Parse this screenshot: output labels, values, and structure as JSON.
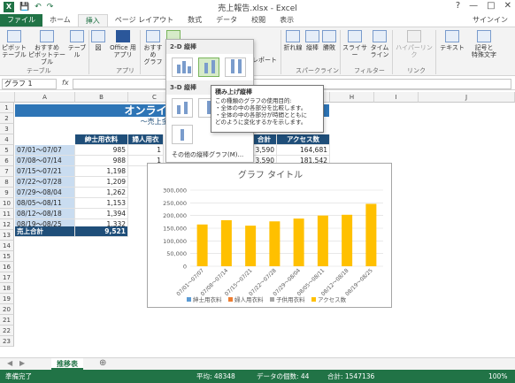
{
  "window": {
    "title": "売上報告.xlsx - Excel",
    "signin": "サインイン",
    "qat_icons": [
      "save-icon",
      "undo-icon",
      "redo-icon"
    ],
    "controls": [
      "?",
      "—",
      "□",
      "✕"
    ]
  },
  "tabs": [
    "ファイル",
    "ホーム",
    "挿入",
    "ページ レイアウト",
    "数式",
    "データ",
    "校閲",
    "表示"
  ],
  "active_tab": "挿入",
  "ribbon": {
    "buttons": [
      {
        "label": "ピボット\nテーブル"
      },
      {
        "label": "おすすめ\nピボットテーブル"
      },
      {
        "label": "テーブル"
      },
      {
        "label": "図"
      },
      {
        "label": "Office 用\nアプリ"
      },
      {
        "label": "おすすめ\nグラフ"
      },
      {
        "label": "レポート"
      },
      {
        "label": "折れ線"
      },
      {
        "label": "縦棒"
      },
      {
        "label": "勝敗"
      },
      {
        "label": "スライサー"
      },
      {
        "label": "タイム\nライン"
      },
      {
        "label": "ハイパーリンク"
      },
      {
        "label": "テキスト"
      },
      {
        "label": "記号と\n特殊文字"
      }
    ],
    "groups": [
      "テーブル",
      "アプリ",
      "スパークライン",
      "フィルター",
      "リンク"
    ]
  },
  "formula_bar": {
    "name_box": "グラフ 1",
    "fx": "fx",
    "value": ""
  },
  "columns": [
    "A",
    "B",
    "C",
    "D",
    "E",
    "F",
    "G",
    "H",
    "I",
    "J"
  ],
  "rows": [
    "1",
    "2",
    "3",
    "4",
    "5",
    "6",
    "7",
    "8",
    "9",
    "10",
    "11",
    "12",
    "13",
    "14",
    "15",
    "16",
    "17",
    "18",
    "19",
    "20",
    "21",
    "22",
    "23"
  ],
  "sheet": {
    "banner": "オンラインショップ",
    "subbanner": "～売上金額・ホーム",
    "col_headers": [
      "紳士用衣料",
      "婦人用衣",
      "合計",
      "アクセス数"
    ],
    "periods": [
      "07/01～07/07",
      "07/08～07/14",
      "07/15～07/21",
      "07/22～07/28",
      "07/29～08/04",
      "08/05～08/11",
      "08/12～08/18",
      "08/19～08/25"
    ],
    "mens": [
      "985",
      "988",
      "1,198",
      "1,209",
      "1,262",
      "1,153",
      "1,394",
      "1,332"
    ],
    "womens_partial": [
      "1",
      "1"
    ],
    "totals_partial": [
      "3,590",
      "3,590"
    ],
    "access": [
      "164,681",
      "181,542"
    ],
    "total_label": "売上合計",
    "total_mens": "9,521"
  },
  "dropdown": {
    "header_2d": "2-D 縦棒",
    "header_3d": "3-D 縦棒",
    "more": "その他の縦棒グラフ(M)..."
  },
  "tooltip": {
    "title": "積み上げ縦棒",
    "body": "この種類のグラフの使用目的:\n・全体の中の各部分を比較します。\n・全体の中の各部分が時間とともに\n  どのように変化するかを示します。"
  },
  "chart_data": {
    "type": "bar",
    "title": "グラフ タイトル",
    "categories": [
      "07/01～07/07",
      "07/08～07/14",
      "07/15～07/21",
      "07/22～07/28",
      "07/29～08/04",
      "08/05～08/11",
      "08/12～08/18",
      "08/19～08/25"
    ],
    "series": [
      {
        "name": "紳士用衣料",
        "values": [
          0,
          0,
          0,
          0,
          0,
          0,
          0,
          0
        ],
        "color": "#5b9bd5"
      },
      {
        "name": "婦人用衣料",
        "values": [
          0,
          0,
          0,
          0,
          0,
          0,
          0,
          0
        ],
        "color": "#ed7d31"
      },
      {
        "name": "子供用衣料",
        "values": [
          0,
          0,
          0,
          0,
          0,
          0,
          0,
          0
        ],
        "color": "#a5a5a5"
      },
      {
        "name": "アクセス数",
        "values": [
          164681,
          181542,
          160000,
          177000,
          188000,
          200000,
          203000,
          246000
        ],
        "color": "#ffc000"
      }
    ],
    "yticks": [
      "0",
      "50,000",
      "100,000",
      "150,000",
      "200,000",
      "250,000",
      "300,000"
    ],
    "ylim": [
      0,
      300000
    ],
    "grid": true,
    "legend": "bottom"
  },
  "sheet_tab": "推移表",
  "status": {
    "ready": "準備完了",
    "average": "平均: 48348",
    "count": "データの個数: 44",
    "sum": "合計: 1547136",
    "zoom": "100%"
  },
  "colors": {
    "excel_green": "#217346",
    "header_blue": "#1f4e79",
    "banner_blue": "#2e75b6",
    "bar": "#ffc000"
  }
}
